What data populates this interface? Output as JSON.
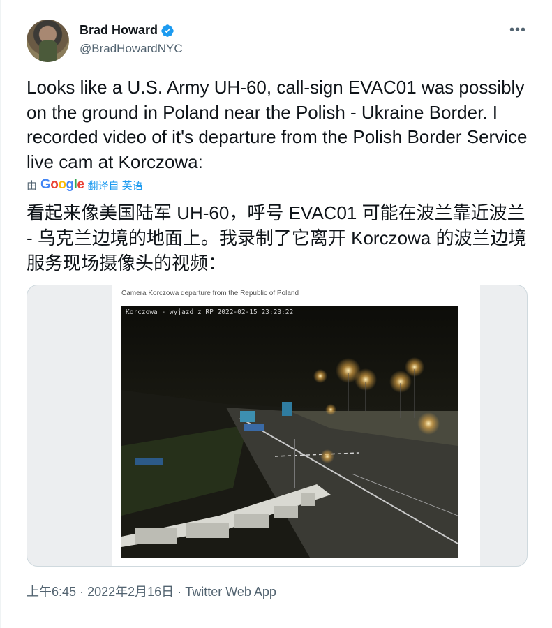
{
  "user": {
    "name": "Brad Howard",
    "handle": "@BradHowardNYC"
  },
  "more_glyph": "•••",
  "tweet": {
    "text": "Looks like a U.S. Army UH-60, call-sign EVAC01 was possibly on the ground in Poland near the Polish - Ukraine Border. I recorded video of it's departure from the Polish Border Service live cam at Korczowa:"
  },
  "translation": {
    "by_label": "由",
    "provider": "Google",
    "translate_label": "翻译自 英语",
    "text": "看起来像美国陆军 UH-60，呼号 EVAC01 可能在波兰靠近波兰 - 乌克兰边境的地面上。我录制了它离开 Korczowa 的波兰边境服务现场摄像头的视频："
  },
  "media": {
    "caption": "Camera Korczowa departure from the Republic of Poland",
    "stamp": "Korczowa - wyjazd z RP 2022-02-15 23:23:22"
  },
  "meta": {
    "time": "上午6:45",
    "date": "2022年2月16日",
    "sep": "·",
    "source": "Twitter Web App"
  },
  "colors": {
    "accent": "#1d9bf0",
    "secondary_text": "#536471"
  }
}
